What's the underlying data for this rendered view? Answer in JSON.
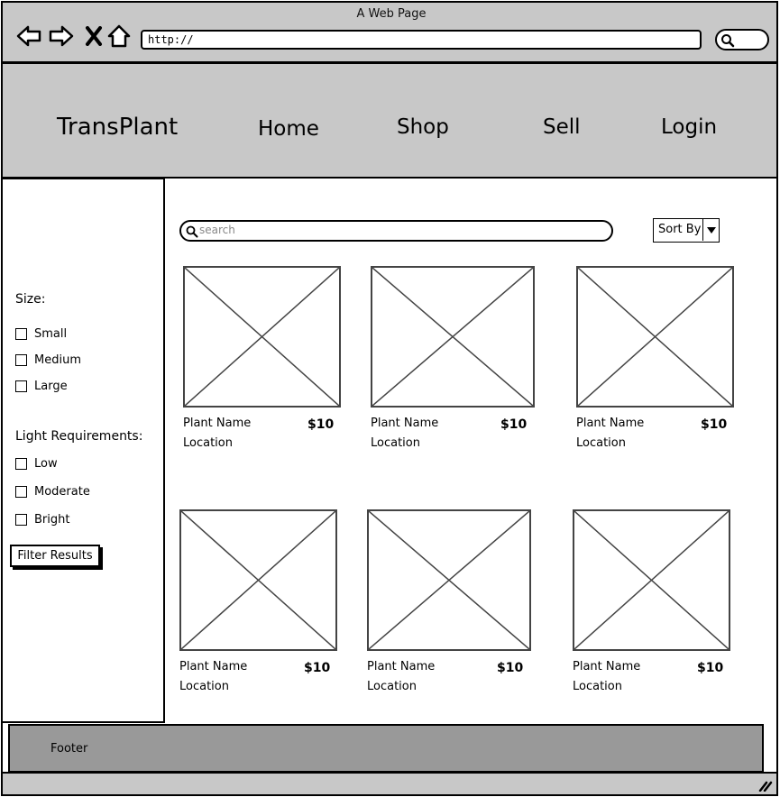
{
  "window": {
    "title": "A Web Page",
    "url": "http://",
    "icons": [
      "back-arrow-icon",
      "forward-arrow-icon",
      "close-x-icon",
      "home-icon",
      "search-icon"
    ]
  },
  "header": {
    "brand": "TransPlant",
    "nav": [
      {
        "label": "Home"
      },
      {
        "label": "Shop"
      },
      {
        "label": "Sell"
      },
      {
        "label": "Login"
      }
    ]
  },
  "sidebar": {
    "size_heading": "Size:",
    "size_options": [
      {
        "label": "Small",
        "checked": false
      },
      {
        "label": "Medium",
        "checked": false
      },
      {
        "label": "Large",
        "checked": false
      }
    ],
    "light_heading": "Light Requirements:",
    "light_options": [
      {
        "label": "Low",
        "checked": false
      },
      {
        "label": "Moderate",
        "checked": false
      },
      {
        "label": "Bright",
        "checked": false
      }
    ],
    "filter_button": "Filter Results"
  },
  "main": {
    "search_placeholder": "search",
    "sort_label": "Sort By",
    "products": [
      {
        "name": "Plant Name",
        "price": "$10",
        "location": "Location"
      },
      {
        "name": "Plant Name",
        "price": "$10",
        "location": "Location"
      },
      {
        "name": "Plant Name",
        "price": "$10",
        "location": "Location"
      },
      {
        "name": "Plant Name",
        "price": "$10",
        "location": "Location"
      },
      {
        "name": "Plant Name",
        "price": "$10",
        "location": "Location"
      },
      {
        "name": "Plant Name",
        "price": "$10",
        "location": "Location"
      }
    ]
  },
  "footer": {
    "label": "Footer"
  },
  "colors": {
    "chrome_gray": "#c8c8c8",
    "footer_gray": "#999999",
    "placeholder_x": "#444444"
  }
}
